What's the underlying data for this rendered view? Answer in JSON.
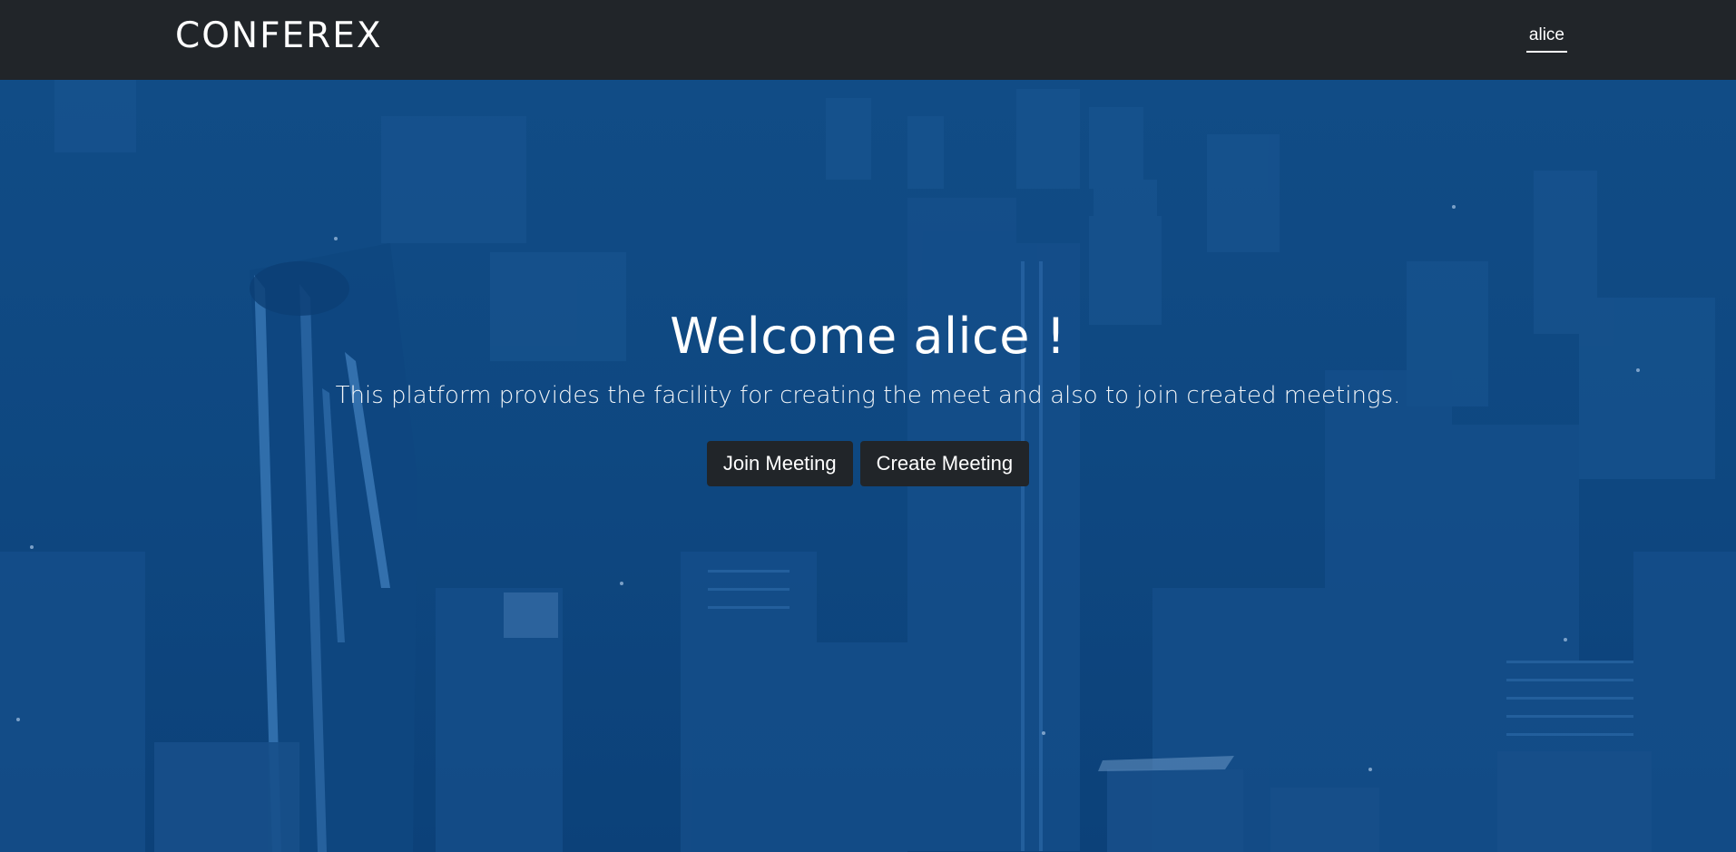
{
  "navbar": {
    "brand": "CONFEREX",
    "user": "alice"
  },
  "hero": {
    "title": "Welcome alice !",
    "subtitle": "This platform provides the facility for creating the meet and also to join created meetings.",
    "join_label": "Join Meeting",
    "create_label": "Create Meeting"
  },
  "colors": {
    "navbar_bg": "#212529",
    "hero_tint": "#0f4a84",
    "button_bg": "#212529",
    "text": "#ffffff"
  }
}
